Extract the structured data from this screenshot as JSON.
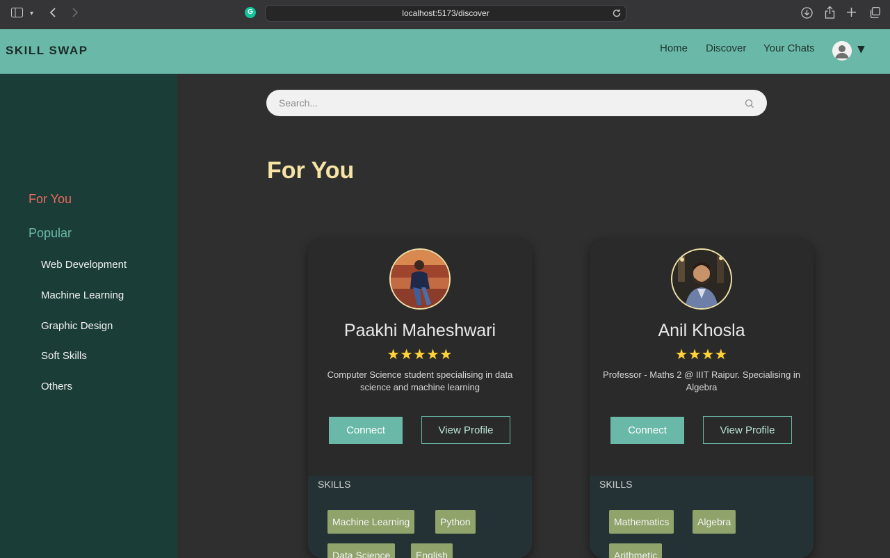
{
  "browser": {
    "url": "localhost:5173/discover",
    "extension_icon": "G"
  },
  "header": {
    "logo": "SKILL SWAP",
    "nav": [
      "Home",
      "Discover",
      "Your Chats"
    ],
    "caret": "▼"
  },
  "sidebar": {
    "for_you": "For You",
    "popular": "Popular",
    "categories": [
      "Web Development",
      "Machine Learning",
      "Graphic Design",
      "Soft Skills",
      "Others"
    ]
  },
  "search": {
    "placeholder": "Search..."
  },
  "main": {
    "title": "For You"
  },
  "cards": [
    {
      "name": "Paakhi Maheshwari",
      "rating": 5,
      "stars": "★★★★★",
      "bio": "Computer Science student specialising in data science and machine learning",
      "connect_label": "Connect",
      "view_label": "View Profile",
      "skills_label": "SKILLS",
      "skills": [
        "Machine Learning",
        "Python",
        "Data Science",
        "English"
      ]
    },
    {
      "name": "Anil Khosla",
      "rating": 4,
      "stars": "★★★★",
      "bio": "Professor - Maths 2 @ IIIT Raipur. Specialising in Algebra",
      "connect_label": "Connect",
      "view_label": "View Profile",
      "skills_label": "SKILLS",
      "skills": [
        "Mathematics",
        "Algebra",
        "Arithmetic"
      ]
    }
  ],
  "colors": {
    "header_bg": "#6ab9a8",
    "sidebar_bg": "#1b3d38",
    "main_bg": "#2f2f2f",
    "active_item": "#e86a5c",
    "accent": "#6ab9a8",
    "title": "#f5e4a4",
    "chip_bg": "#8fa36b"
  }
}
